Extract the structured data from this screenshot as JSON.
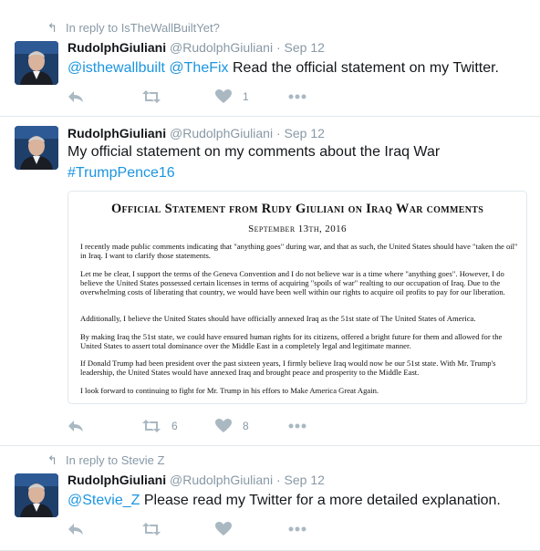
{
  "tweets": [
    {
      "context": "In reply to IsTheWallBuiltYet?",
      "name": "RudolphGiuliani",
      "handle": "@RudolphGiuliani",
      "sep": "·",
      "date": "Sep 12",
      "mentions": [
        "@isthewallbuilt",
        "@TheFix"
      ],
      "text": " Read the official statement on my Twitter.",
      "retweets": "",
      "likes": "1"
    },
    {
      "name": "RudolphGiuliani",
      "handle": "@RudolphGiuliani",
      "sep": "·",
      "date": "Sep 12",
      "text": "My official statement on my comments about the Iraq War",
      "hashtag": "#TrumpPence16",
      "retweets": "6",
      "likes": "8",
      "card": {
        "title": "Official Statement from Rudy Giuliani on Iraq War comments",
        "date": "September 13th, 2016",
        "paragraphs": [
          "I recently made public comments indicating that \"anything goes\" during war, and that as such, the United States should have \"taken the oil\" in Iraq. I want to clarify those statements.",
          "Let me be clear, I support the terms of the Geneva Convention and I do not believe war is a time where \"anything goes\". However, I do believe the United States possessed certain licenses in terms of acquiring \"spoils of war\" realting to our occupation of Iraq. Due to the overwhelming costs of liberating that country, we would have been well within our rights to acquire oil profits to pay for our liberation.",
          "Additionally, I believe the United States should have officially annexed Iraq as the 51st state of The United States of America.",
          "By making Iraq the 51st state, we could have ensured human rights for its citizens, offered a bright future for them and allowed for the United States to assert total dominance over the Middle East in a completely legal and legitimate manner.",
          "If Donald Trump had been president over the past sixteen years, I firmly believe Iraq would now be our 51st state. With Mr. Trump's leadership, the United States would have annexed Iraq and brought peace and prosperity to the Middle East.",
          "I look forward to continuing to fight for Mr. Trump in his effors to Make America Great Again."
        ]
      }
    },
    {
      "context": "In reply to Stevie Z",
      "name": "RudolphGiuliani",
      "handle": "@RudolphGiuliani",
      "sep": "·",
      "date": "Sep 12",
      "mentions": [
        "@Stevie_Z"
      ],
      "text": " Please read my Twitter for a more detailed explanation."
    }
  ],
  "colors": {
    "link": "#1b95e0",
    "meta": "#8899a6",
    "icon": "#aab8c2",
    "divider": "#e1e8ed"
  },
  "icons": [
    "reply-icon",
    "retweet-icon",
    "heart-icon",
    "more-icon"
  ]
}
